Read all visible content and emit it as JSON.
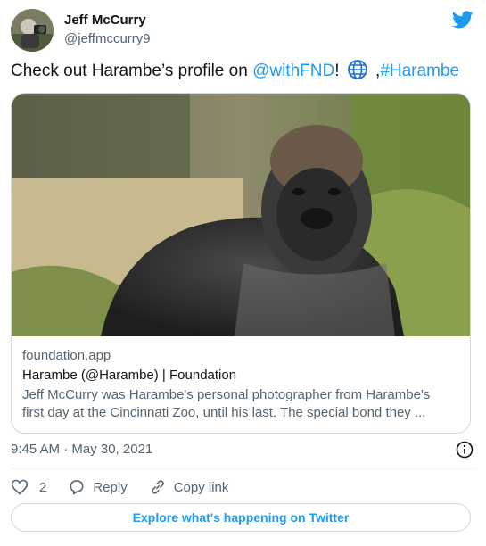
{
  "user": {
    "display_name": "Jeff McCurry",
    "handle": "@jeffmccurry9"
  },
  "tweet": {
    "text_intro": "Check out Harambe’s profile on ",
    "mention": "@withFND",
    "text_after_mention": "!",
    "text_sep": " ,",
    "hashtag": "#Harambe"
  },
  "card": {
    "domain": "foundation.app",
    "title": "Harambe (@Harambe) | Foundation",
    "description": "Jeff McCurry was Harambe's personal photographer from Harambe's\nfirst day at the Cincinnati Zoo, until his last. The special bond they ..."
  },
  "timestamp": "9:45 AM · May 30, 2021",
  "actions": {
    "like_count": "2",
    "reply_label": "Reply",
    "copy_link_label": "Copy link"
  },
  "explore_label": "Explore what's happening on Twitter",
  "colors": {
    "accent": "#1d9bf0",
    "text": "#0f1419",
    "muted": "#536471",
    "border": "#cfd9de"
  },
  "icons": [
    "twitter-bird-icon",
    "globe-icon",
    "info-icon",
    "heart-icon",
    "reply-icon",
    "link-icon"
  ]
}
